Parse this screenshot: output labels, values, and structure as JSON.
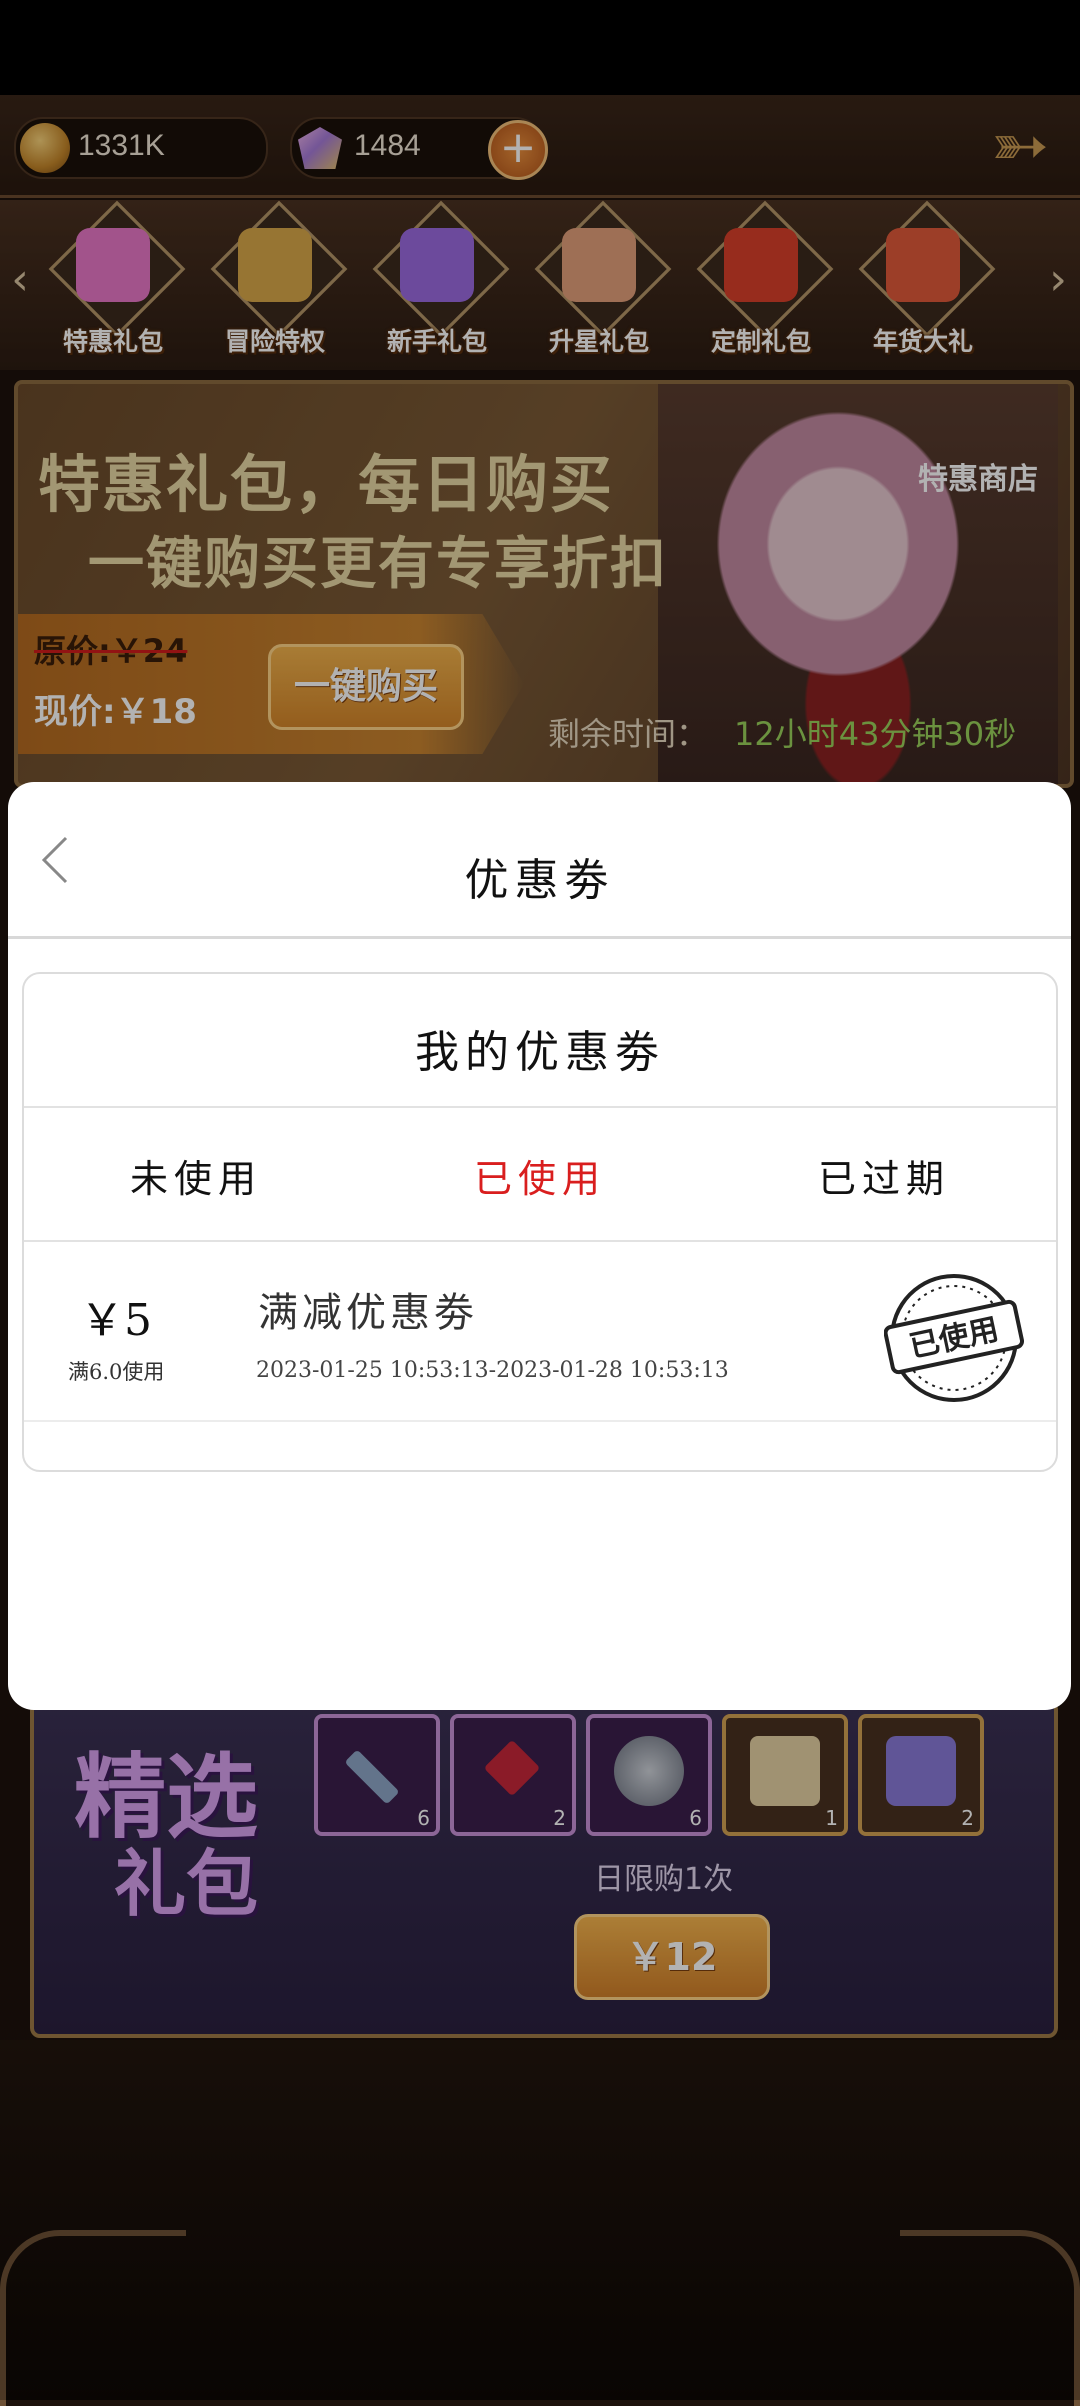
{
  "resources": {
    "gold": "1331K",
    "gems": "1484"
  },
  "categories": [
    {
      "label": "特惠礼包",
      "color": "#e878c8"
    },
    {
      "label": "冒险特权",
      "color": "#d8a84a"
    },
    {
      "label": "新手礼包",
      "color": "#9b6be0"
    },
    {
      "label": "升星礼包",
      "color": "#e2a07a"
    },
    {
      "label": "定制礼包",
      "color": "#d8402a"
    },
    {
      "label": "年货大礼",
      "color": "#e05a3a"
    }
  ],
  "banner": {
    "headline": "特惠礼包，每日购买",
    "subline": "一键购买更有专享折扣",
    "shop_label": "特惠商店",
    "original_price": "原价:￥24",
    "current_price": "现价:￥18",
    "buy_button": "一键购买",
    "timer_label": "剩余时间：",
    "timer_value": "12小时43分钟30秒"
  },
  "featured": {
    "title_line1": "精选",
    "title_line2": "礼包",
    "items": [
      {
        "count": "6",
        "icon": "pickaxe-icon"
      },
      {
        "count": "2",
        "icon": "knot-charm-icon"
      },
      {
        "count": "6",
        "icon": "orb-icon"
      },
      {
        "count": "1",
        "icon": "scroll-icon"
      },
      {
        "count": "2",
        "icon": "chest-icon"
      }
    ],
    "limit_text": "日限购1次",
    "price_button": "￥12"
  },
  "dialog": {
    "title": "优惠劵",
    "card_title": "我的优惠劵",
    "tabs": [
      "未使用",
      "已使用",
      "已过期"
    ],
    "active_tab_index": 1,
    "active_color": "#d91e1e",
    "coupon": {
      "amount": "￥5",
      "condition": "满6.0使用",
      "name": "满减优惠劵",
      "validity": "2023-01-25 10:53:13-2023-01-28 10:53:13",
      "stamp": "已使用"
    }
  }
}
